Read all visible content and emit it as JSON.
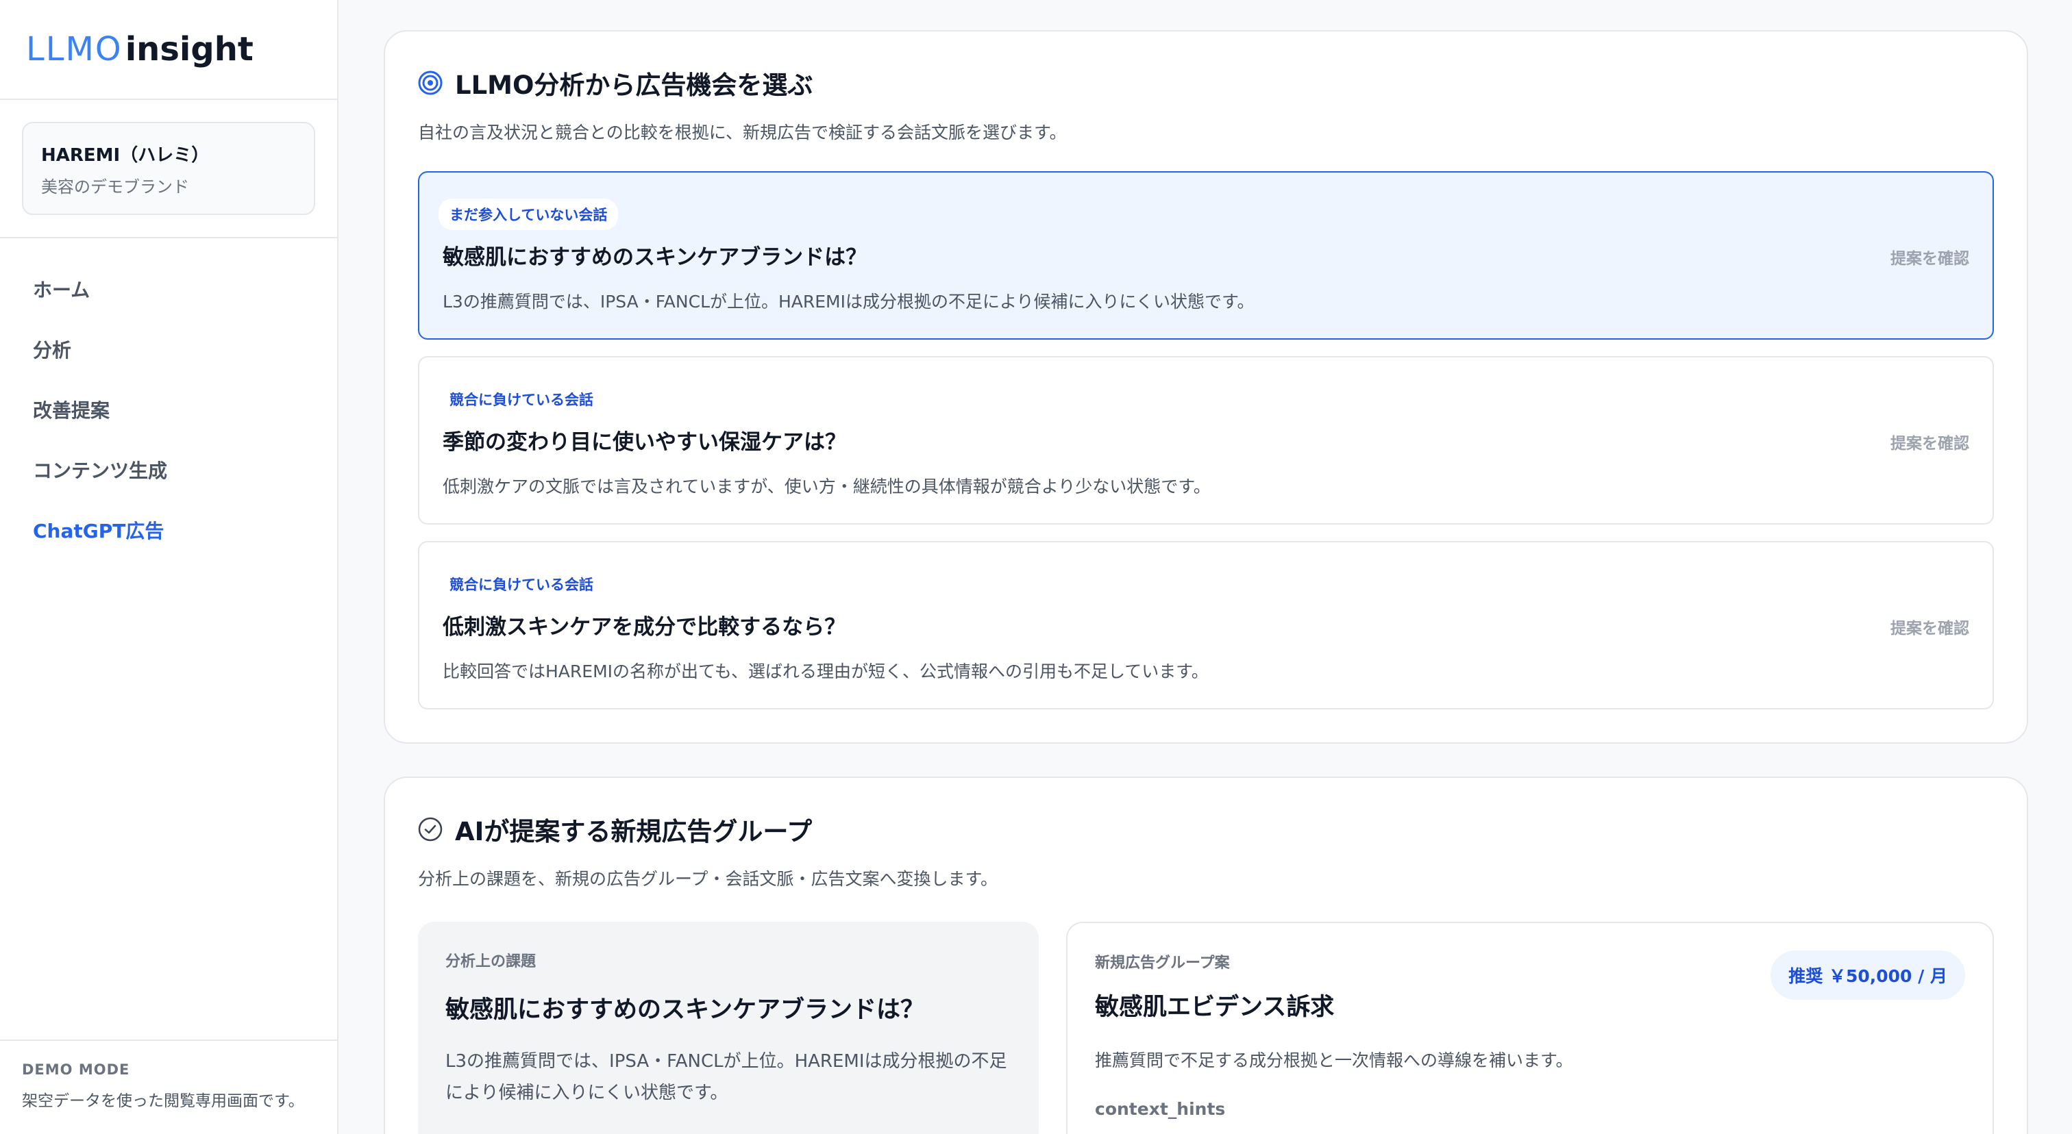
{
  "logo": {
    "part1": "LLMO",
    "part2": "insight"
  },
  "brand": {
    "name": "HAREMI（ハレミ）",
    "subtitle": "美容のデモブランド"
  },
  "nav": [
    {
      "label": "ホーム",
      "active": false
    },
    {
      "label": "分析",
      "active": false
    },
    {
      "label": "改善提案",
      "active": false
    },
    {
      "label": "コンテンツ生成",
      "active": false
    },
    {
      "label": "ChatGPT広告",
      "active": true
    }
  ],
  "demo": {
    "title": "DEMO MODE",
    "text": "架空データを使った閲覧専用画面です。"
  },
  "opportunities": {
    "title": "LLMO分析から広告機会を選ぶ",
    "description": "自社の言及状況と競合との比較を根拠に、新規広告で検証する会話文脈を選びます。",
    "items": [
      {
        "badge": "まだ参入していない会話",
        "question": "敏感肌におすすめのスキンケアブランドは？",
        "detail": "L3の推薦質問では、IPSA・FANCLが上位。HAREMIは成分根拠の不足により候補に入りにくい状態です。",
        "link": "提案を確認",
        "selected": true
      },
      {
        "badge": "競合に負けている会話",
        "question": "季節の変わり目に使いやすい保湿ケアは？",
        "detail": "低刺激ケアの文脈では言及されていますが、使い方・継続性の具体情報が競合より少ない状態です。",
        "link": "提案を確認",
        "selected": false
      },
      {
        "badge": "競合に負けている会話",
        "question": "低刺激スキンケアを成分で比較するなら？",
        "detail": "比較回答ではHAREMIの名称が出ても、選ばれる理由が短く、公式情報への引用も不足しています。",
        "link": "提案を確認",
        "selected": false
      }
    ]
  },
  "ad_groups": {
    "title": "AIが提案する新規広告グループ",
    "description": "分析上の課題を、新規の広告グループ・会話文脈・広告文案へ変換します。",
    "issue": {
      "label": "分析上の課題",
      "question": "敏感肌におすすめのスキンケアブランドは？",
      "detail": "L3の推薦質問では、IPSA・FANCLが上位。HAREMIは成分根拠の不足により候補に入りにくい状態です。"
    },
    "proposal": {
      "label": "新規広告グループ案",
      "name": "敏感肌エビデンス訴求",
      "budget": "推奨 ￥50,000 / 月",
      "detail": "推薦質問で不足する成分根拠と一次情報への導線を補います。",
      "hints_label": "context_hints"
    }
  },
  "colors": {
    "accent": "#2563eb",
    "selected_bg": "#eef5ff",
    "border": "#e5e7eb"
  }
}
